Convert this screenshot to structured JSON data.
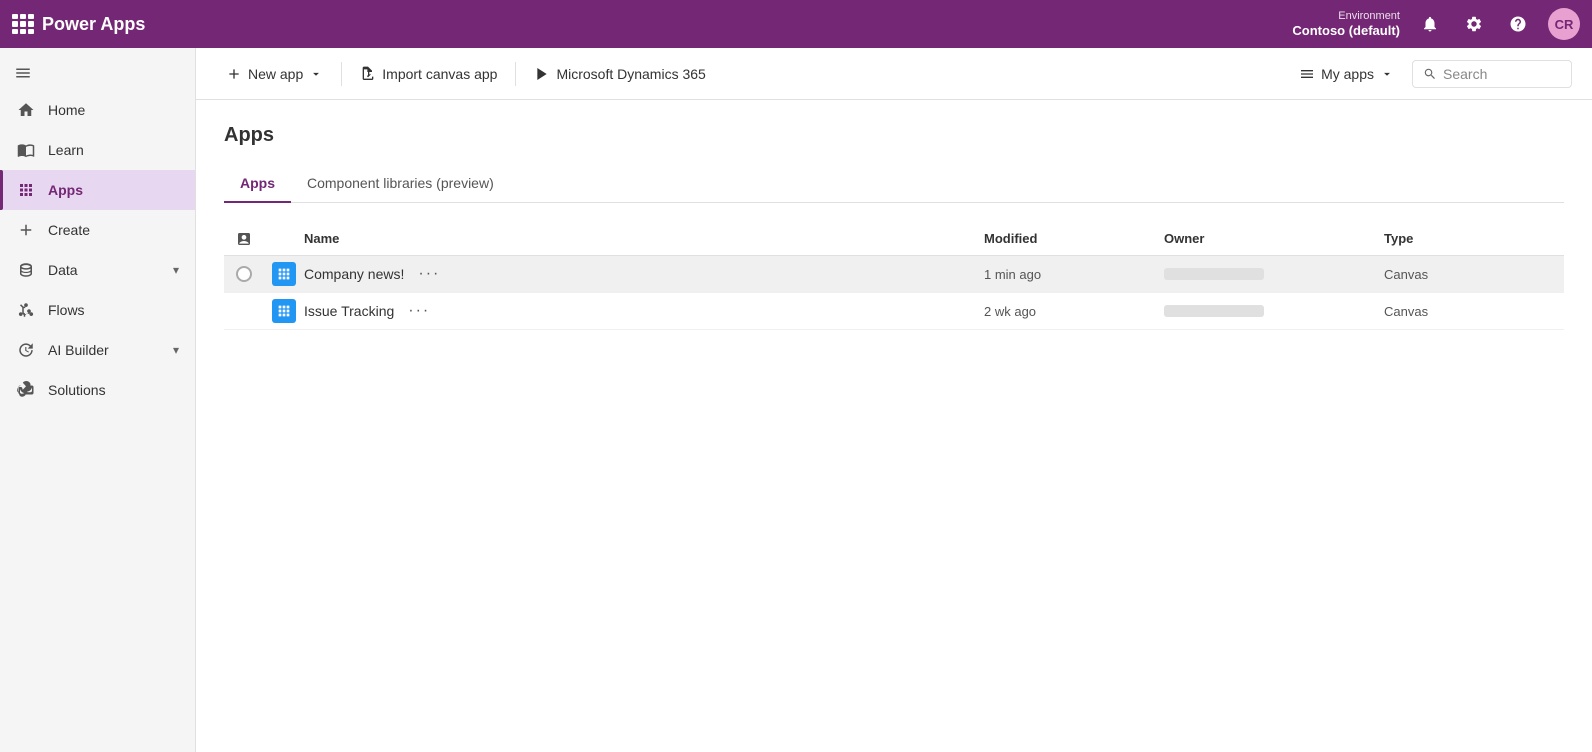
{
  "topnav": {
    "app_name": "Power Apps",
    "environment_label": "Environment",
    "environment_name": "Contoso (default)",
    "avatar_initials": "CR"
  },
  "sidebar": {
    "collapse_icon": "≡",
    "items": [
      {
        "id": "home",
        "label": "Home",
        "icon": "home"
      },
      {
        "id": "learn",
        "label": "Learn",
        "icon": "book"
      },
      {
        "id": "apps",
        "label": "Apps",
        "icon": "apps",
        "active": true
      },
      {
        "id": "create",
        "label": "Create",
        "icon": "plus"
      },
      {
        "id": "data",
        "label": "Data",
        "icon": "data",
        "has_chevron": true
      },
      {
        "id": "flows",
        "label": "Flows",
        "icon": "flows"
      },
      {
        "id": "aibuilder",
        "label": "AI Builder",
        "icon": "ai",
        "has_chevron": true
      },
      {
        "id": "solutions",
        "label": "Solutions",
        "icon": "solutions"
      }
    ]
  },
  "toolbar": {
    "new_app_label": "New app",
    "import_canvas_label": "Import canvas app",
    "dynamics_label": "Microsoft Dynamics 365",
    "my_apps_label": "My apps",
    "search_placeholder": "Search"
  },
  "page": {
    "title": "Apps",
    "tabs": [
      {
        "id": "apps",
        "label": "Apps",
        "active": true
      },
      {
        "id": "component_libraries",
        "label": "Component libraries (preview)",
        "active": false
      }
    ]
  },
  "table": {
    "columns": [
      {
        "id": "check",
        "label": ""
      },
      {
        "id": "icon",
        "label": ""
      },
      {
        "id": "name",
        "label": "Name"
      },
      {
        "id": "modified",
        "label": "Modified"
      },
      {
        "id": "owner",
        "label": "Owner"
      },
      {
        "id": "type",
        "label": "Type"
      }
    ],
    "rows": [
      {
        "id": "company-news",
        "name": "Company news!",
        "modified": "1 min ago",
        "type": "Canvas",
        "hovered": true
      },
      {
        "id": "issue-tracking",
        "name": "Issue Tracking",
        "modified": "2 wk ago",
        "type": "Canvas",
        "hovered": false
      }
    ]
  }
}
